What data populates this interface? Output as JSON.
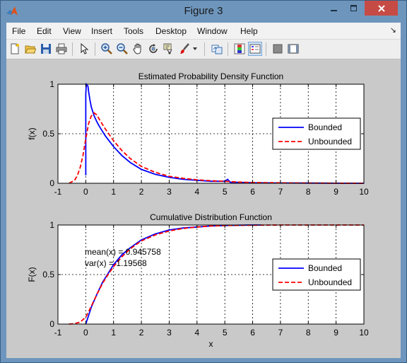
{
  "window": {
    "title": "Figure 3"
  },
  "menubar": {
    "items": [
      {
        "label": "File"
      },
      {
        "label": "Edit"
      },
      {
        "label": "View"
      },
      {
        "label": "Insert"
      },
      {
        "label": "Tools"
      },
      {
        "label": "Desktop"
      },
      {
        "label": "Window"
      },
      {
        "label": "Help"
      }
    ]
  },
  "toolbar": {
    "icons": [
      "new-figure-icon",
      "open-file-icon",
      "save-icon",
      "print-icon",
      "pointer-icon",
      "zoom-in-icon",
      "zoom-out-icon",
      "pan-hand-icon",
      "rotate-3d-icon",
      "data-cursor-icon",
      "brush-icon",
      "brush-dropdown-icon",
      "link-plot-icon",
      "colorbar-icon",
      "legend-icon",
      "hide-plot-tools-icon",
      "show-plot-tools-icon"
    ]
  },
  "chart_data": [
    {
      "type": "line",
      "title": "Estimated Probability Density Function",
      "xlabel": "",
      "ylabel": "f(x)",
      "xlim": [
        -1,
        10
      ],
      "ylim": [
        0,
        1
      ],
      "xticks": [
        "-1",
        "0",
        "1",
        "2",
        "3",
        "4",
        "5",
        "6",
        "7",
        "8",
        "9",
        "10"
      ],
      "yticks": [
        "0",
        "0.5",
        "1"
      ],
      "grid": true,
      "legend_position": "right",
      "series": [
        {
          "name": "Bounded",
          "color": "#0000ff",
          "style": "solid",
          "x": [
            0,
            0,
            0.02,
            0.05,
            0.08,
            0.1,
            0.15,
            0.2,
            0.3,
            0.4,
            0.5,
            0.7,
            1.0,
            1.3,
            1.6,
            2.0,
            2.5,
            3.0,
            3.5,
            4.0,
            4.5,
            5.0,
            5.1,
            5.2,
            5.5,
            6.0,
            7.0,
            8.0,
            9.0,
            10.0
          ],
          "y": [
            0.08,
            0.9,
            1.0,
            0.99,
            0.98,
            0.93,
            0.84,
            0.77,
            0.68,
            0.62,
            0.57,
            0.48,
            0.37,
            0.28,
            0.21,
            0.14,
            0.09,
            0.06,
            0.04,
            0.03,
            0.02,
            0.02,
            0.04,
            0.01,
            0.01,
            0.005,
            0.003,
            0.002,
            0.001,
            0.0
          ]
        },
        {
          "name": "Unbounded",
          "color": "#ff0000",
          "style": "dashed",
          "x": [
            -0.6,
            -0.4,
            -0.3,
            -0.2,
            -0.1,
            0.0,
            0.1,
            0.2,
            0.3,
            0.4,
            0.5,
            0.7,
            1.0,
            1.3,
            1.6,
            2.0,
            2.5,
            3.0,
            3.5,
            4.0,
            4.5,
            5.0,
            5.5,
            6.0,
            7.0,
            8.0,
            9.0,
            10.0
          ],
          "y": [
            0.0,
            0.03,
            0.08,
            0.16,
            0.28,
            0.45,
            0.6,
            0.68,
            0.71,
            0.69,
            0.64,
            0.55,
            0.43,
            0.33,
            0.25,
            0.17,
            0.11,
            0.07,
            0.05,
            0.035,
            0.025,
            0.02,
            0.012,
            0.008,
            0.004,
            0.002,
            0.001,
            0.0
          ]
        }
      ]
    },
    {
      "type": "line",
      "title": "Cumulative Distribution Function",
      "xlabel": "x",
      "ylabel": "F(x)",
      "xlim": [
        -1,
        10
      ],
      "ylim": [
        0,
        1
      ],
      "xticks": [
        "-1",
        "0",
        "1",
        "2",
        "3",
        "4",
        "5",
        "6",
        "7",
        "8",
        "9",
        "10"
      ],
      "yticks": [
        "0",
        "0.5",
        "1"
      ],
      "grid": true,
      "legend_position": "right",
      "annotations": [
        "mean(x) = 0.945758",
        "var(x) = 1.19568"
      ],
      "series": [
        {
          "name": "Bounded",
          "color": "#0000ff",
          "style": "solid",
          "x": [
            0,
            0.2,
            0.4,
            0.6,
            0.8,
            1.0,
            1.3,
            1.6,
            2.0,
            2.5,
            3.0,
            3.5,
            4.0,
            4.5,
            5.0,
            5.5,
            6.0,
            6.3
          ],
          "y": [
            0.0,
            0.17,
            0.3,
            0.42,
            0.51,
            0.6,
            0.7,
            0.77,
            0.85,
            0.91,
            0.95,
            0.97,
            0.98,
            0.99,
            0.995,
            0.998,
            1.0,
            1.0
          ]
        },
        {
          "name": "Unbounded",
          "color": "#ff0000",
          "style": "dashed",
          "x": [
            -0.6,
            -0.4,
            -0.2,
            0.0,
            0.2,
            0.4,
            0.6,
            0.8,
            1.0,
            1.3,
            1.6,
            2.0,
            2.5,
            3.0,
            3.5,
            4.0,
            4.5,
            5.0,
            6.0,
            7.0,
            8.0,
            9.0,
            10.0
          ],
          "y": [
            0.0,
            0.005,
            0.02,
            0.07,
            0.18,
            0.3,
            0.41,
            0.5,
            0.58,
            0.68,
            0.76,
            0.84,
            0.9,
            0.94,
            0.965,
            0.98,
            0.99,
            0.995,
            0.998,
            1.0,
            1.0,
            1.0,
            1.0
          ]
        }
      ]
    }
  ]
}
